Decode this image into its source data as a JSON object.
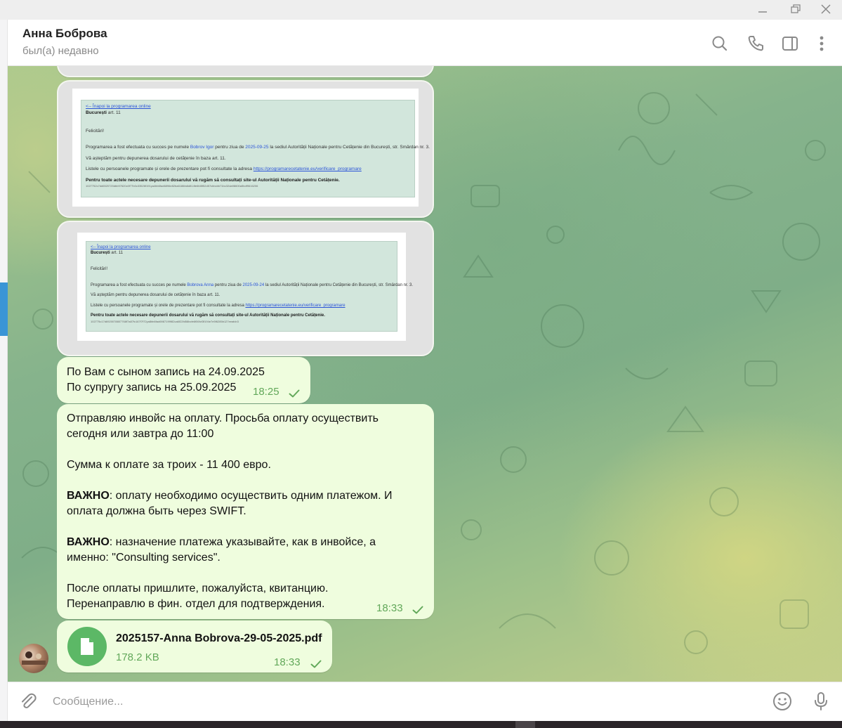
{
  "chat": {
    "name": "Анна Боброва",
    "status": "был(а) недавно"
  },
  "screenshots": [
    {
      "back_link": "<-- Înapoi la programarea online",
      "city": "București",
      "art": " art. 11",
      "felicitari": "Felicitări!",
      "line1_a": "Programarea a fost efectuata cu succes pe numele ",
      "line1_name": "Bobrov Igor",
      "line1_b": " pentru ziua de ",
      "line1_date": "2025-09-25",
      "line1_c": " la sediul Autorității Naționale pentru Cetățenie din București, str. Smârdan nr. 3.",
      "line2": "Vă așteptăm pentru depunerea dosarului de cetățenie în baza art. 11.",
      "line3": "Listele cu persoanele programate și orele de prezentare pot fi consultate la adresa ",
      "line3_link": "https://programarecetatenie.eu/verificare_programare",
      "bold_note": "Pentru toate actele necesare depunerii dosarului vă rugăm să consultați site-ul Autorității Naționale pentru Cetățenie.",
      "hash": "1027752c7dd6520720dbb97620c0f77b0c33526f191ya4bb6fad6896e82ba6186fa6d814fe6fd5f52d57cbbcbb71bc32da98600a5bdf9616206"
    },
    {
      "back_link": "<-- Înapoi la programarea online",
      "city": "București",
      "art": " art. 11",
      "felicitari": "Felicitări!",
      "line1_a": "Programarea a fost efectuata cu succes pe numele ",
      "line1_name": "Bobrova Anna",
      "line1_b": " pentru ziua de ",
      "line1_date": "2025-09-24",
      "line1_c": " la sediul Autorității Naționale pentru Cetățenie din București, str. Smârdan nr. 3.",
      "line2": "Vă așteptăm pentru depunerea dosarului de cetățenie în baza art. 11.",
      "line3": "Listele cu persoanele programate și orele de prezentare pot fi consultate la adresa ",
      "line3_link": "https://programarecetatenie.eu/verificare_programare",
      "bold_note": "Pentru toate actele necesare depunerii dosarului vă rugăm să consultați site-ul Autorității Naționale pentru Cetățenie.",
      "hash": "102775c17d6920078807768f7a87fc167f7f72ya8bb6fad6987199f82ca6f22fd58bcfe6f06fcf3f194e7e5f6285b127eeafcb3"
    }
  ],
  "messages": [
    {
      "line1": "По Вам с сыном запись на 24.09.2025",
      "line2": "По супругу запись на 25.09.2025",
      "time": "18:25"
    },
    {
      "p1_l1": "Отправляю инвойс на оплату. Просьба оплату осуществить",
      "p1_l2": "сегодня или завтра до 11:00",
      "p2": "Сумма к оплате за троих - 11 400 евро.",
      "p3_bold": "ВАЖНО",
      "p3_l1": ": оплату необходимо осуществить одним платежом. И",
      "p3_l2": "оплата должна быть через SWIFT.",
      "p4_bold": "ВАЖНО",
      "p4_l1": ": назначение платежа указывайте, как в инвойсе, а",
      "p4_l2": "именно: \"Consulting services\".",
      "p5_l1": "После оплаты пришлите, пожалуйста, квитанцию.",
      "p5_l2": "Перенаправлю в фин. отдел для подтверждения.",
      "time": "18:33"
    },
    {
      "file_name": "2025157-Anna Bobrova-29-05-2025.pdf",
      "file_size": "178.2 KB",
      "time": "18:33"
    }
  ],
  "input": {
    "placeholder": "Сообщение..."
  },
  "icons": {
    "search": "search-icon",
    "phone": "phone-icon",
    "panel": "sidebar-toggle-icon",
    "more": "more-vertical-icon",
    "attach": "paperclip-icon",
    "emoji": "emoji-icon",
    "mic": "microphone-icon",
    "file": "file-icon",
    "check": "check-icon"
  },
  "colors": {
    "bubble": "#effdde",
    "meta_green": "#62a85a",
    "file_green": "#5cb866",
    "accent_blue": "#3a95d6"
  }
}
